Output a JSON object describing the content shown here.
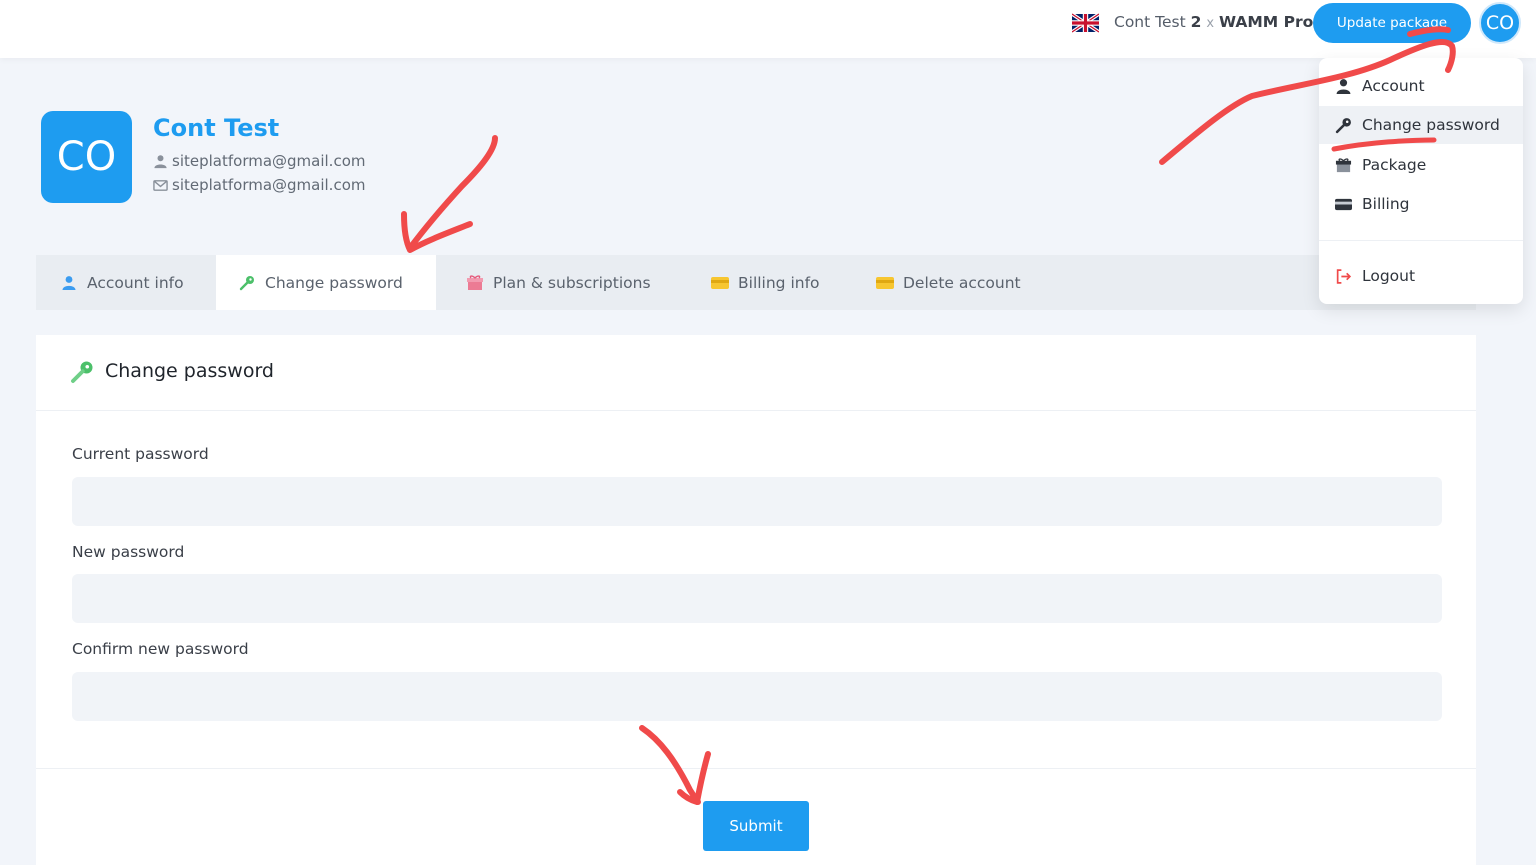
{
  "header": {
    "account_name": "Cont Test",
    "plan_count": "2",
    "plan_separator": "x",
    "plan_name": "WAMM Pro",
    "update_button": "Update package",
    "avatar_initials": "CO"
  },
  "profile": {
    "avatar_initials": "CO",
    "name": "Cont Test",
    "username": "siteplatforma@gmail.com",
    "email": "siteplatforma@gmail.com"
  },
  "tabs": [
    {
      "label": "Account info"
    },
    {
      "label": "Change password"
    },
    {
      "label": "Plan & subscriptions"
    },
    {
      "label": "Billing info"
    },
    {
      "label": "Delete account"
    }
  ],
  "form": {
    "title": "Change password",
    "current_label": "Current password",
    "new_label": "New password",
    "confirm_label": "Confirm new password",
    "submit": "Submit"
  },
  "dropdown": {
    "items": [
      {
        "label": "Account"
      },
      {
        "label": "Change password"
      },
      {
        "label": "Package"
      },
      {
        "label": "Billing"
      },
      {
        "label": "Logout"
      }
    ]
  },
  "colors": {
    "accent": "#1e9cf0",
    "annotation": "#f04a4a"
  }
}
